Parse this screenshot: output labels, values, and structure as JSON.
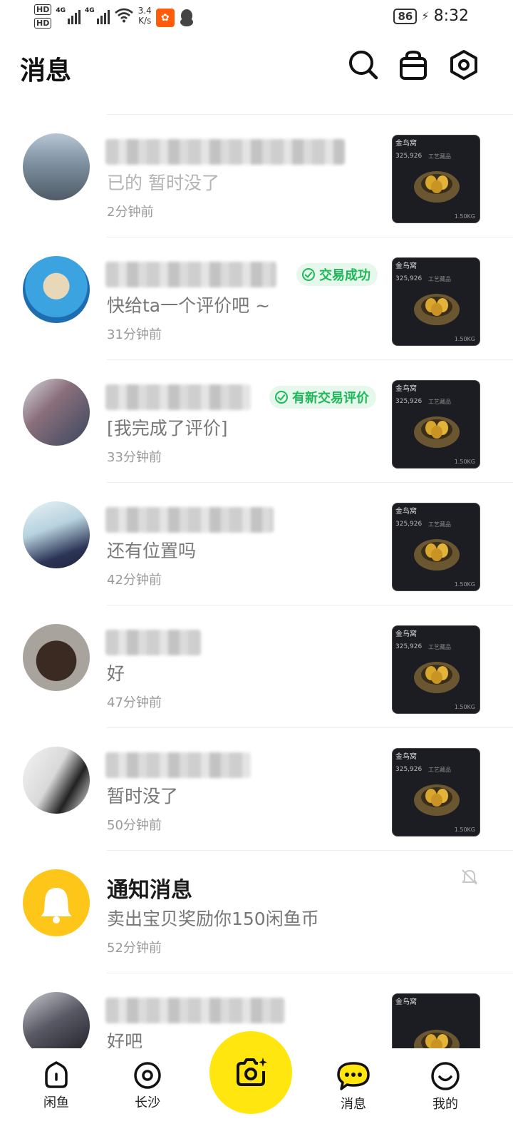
{
  "status_bar": {
    "hd1": "HD",
    "hd2": "HD",
    "sig1": "4G",
    "sig2": "4G",
    "speed_value": "3.4",
    "speed_unit": "K/s",
    "battery": "86",
    "time": "8:32"
  },
  "header": {
    "title": "消息",
    "icons": [
      "search-icon",
      "shop-bag-icon",
      "settings-hex-icon"
    ]
  },
  "conversations": [
    {
      "message": "已的 暂时没了",
      "time": "2分钟前",
      "badge": "",
      "thumb_label": "金鸟窝",
      "thumb_num": "325,926",
      "thumb_note": "工艺藏品",
      "thumb_weight": "1.50KG"
    },
    {
      "message": "快给ta一个评价吧 ~",
      "time": "31分钟前",
      "badge": "交易成功",
      "thumb_label": "金鸟窝",
      "thumb_num": "325,926",
      "thumb_note": "工艺藏品",
      "thumb_weight": "1.50KG"
    },
    {
      "message": "[我完成了评价]",
      "time": "33分钟前",
      "badge": "有新交易评价",
      "thumb_label": "金鸟窝",
      "thumb_num": "325,926",
      "thumb_note": "工艺藏品",
      "thumb_weight": "1.50KG"
    },
    {
      "message": "还有位置吗",
      "time": "42分钟前",
      "badge": "",
      "thumb_label": "金鸟窝",
      "thumb_num": "325,926",
      "thumb_note": "工艺藏品",
      "thumb_weight": "1.50KG"
    },
    {
      "message": "好",
      "time": "47分钟前",
      "badge": "",
      "thumb_label": "金鸟窝",
      "thumb_num": "325,926",
      "thumb_note": "工艺藏品",
      "thumb_weight": "1.50KG"
    },
    {
      "message": "暂时没了",
      "time": "50分钟前",
      "badge": "",
      "thumb_label": "金鸟窝",
      "thumb_num": "325,926",
      "thumb_note": "工艺藏品",
      "thumb_weight": "1.50KG"
    }
  ],
  "notice": {
    "title": "通知消息",
    "message": "卖出宝贝奖励你150闲鱼币",
    "time": "52分钟前"
  },
  "last_conversation": {
    "message": "好吧",
    "thumb_label": "金鸟窝"
  },
  "bottom_nav": {
    "home": "闲鱼",
    "local": "长沙",
    "messages": "消息",
    "mine": "我的"
  },
  "colors": {
    "accent_yellow": "#ffe60f",
    "success_green": "#1fb858",
    "badge_bg": "#e6f8ec"
  }
}
